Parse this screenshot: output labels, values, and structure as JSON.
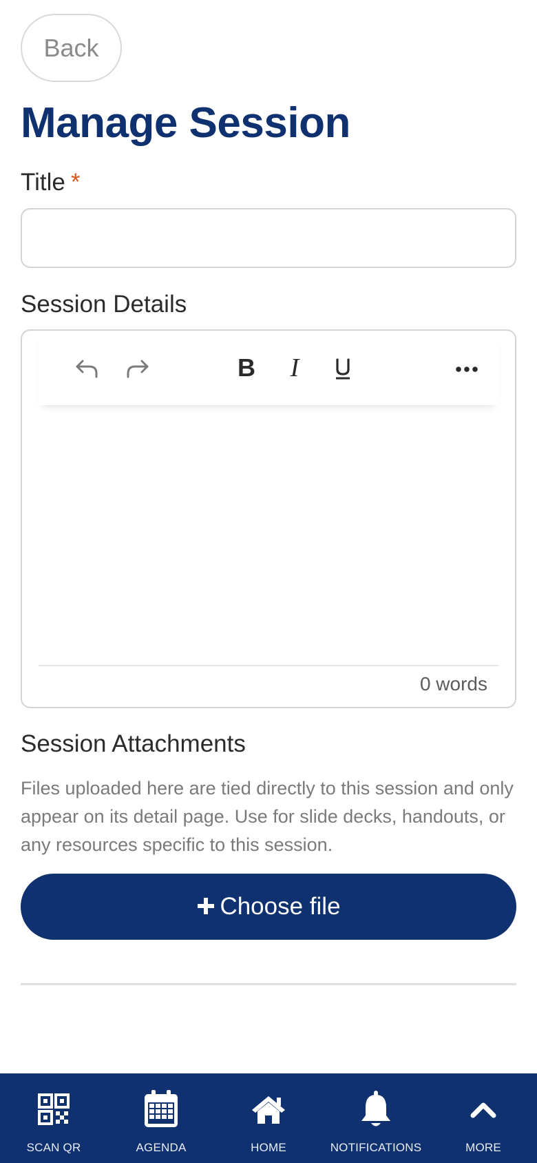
{
  "header": {
    "back_label": "Back",
    "title": "Manage Session"
  },
  "form": {
    "title_label": "Title",
    "required_mark": "*",
    "title_value": "",
    "details_label": "Session Details",
    "word_count": "0 words",
    "attachments_label": "Session Attachments",
    "attachments_help": "Files uploaded here are tied directly to this session and only appear on its detail page. Use for slide decks, handouts, or any resources specific to this session.",
    "choose_file_label": "Choose file",
    "choose_file_icon": "plus-icon"
  },
  "toolbar": {
    "buttons": [
      "undo-icon",
      "redo-icon",
      "bold-icon",
      "italic-icon",
      "underline-icon",
      "more-icon"
    ]
  },
  "bottom_nav": {
    "items": [
      {
        "label": "SCAN QR",
        "icon": "qr-code-icon"
      },
      {
        "label": "AGENDA",
        "icon": "calendar-icon"
      },
      {
        "label": "HOME",
        "icon": "home-icon"
      },
      {
        "label": "NOTIFICATIONS",
        "icon": "bell-icon"
      },
      {
        "label": "MORE",
        "icon": "chevron-up-icon"
      }
    ]
  },
  "colors": {
    "brand": "#0f3170",
    "required": "#d45a1f",
    "muted_text": "#7a7a7a"
  }
}
